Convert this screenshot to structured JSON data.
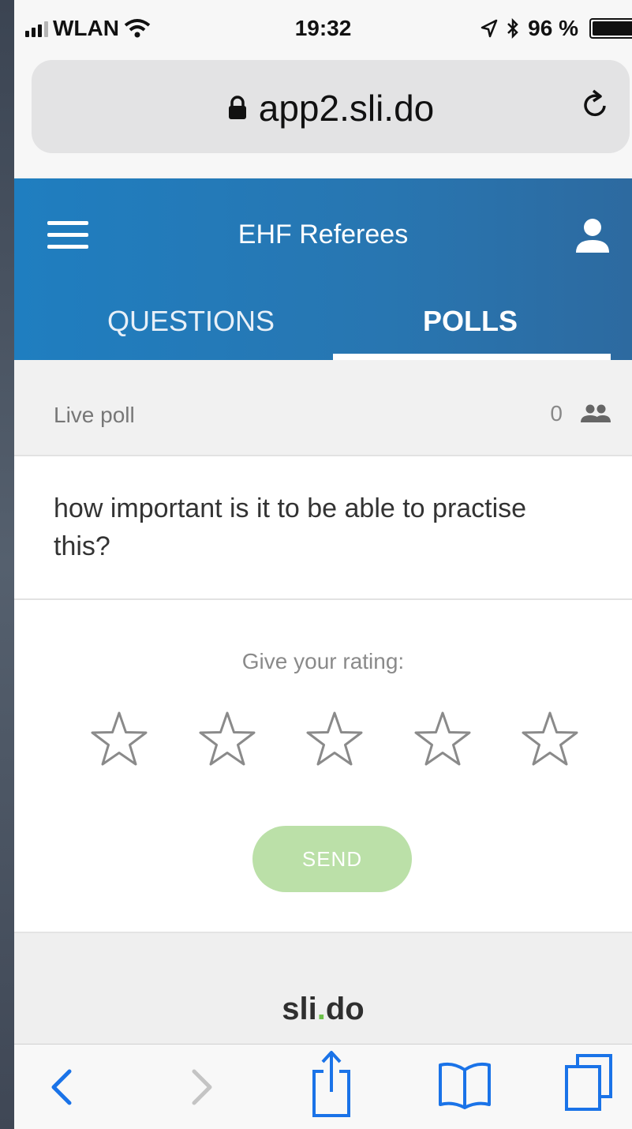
{
  "status_bar": {
    "carrier": "WLAN",
    "time": "19:32",
    "battery": "96 %"
  },
  "browser": {
    "url": "app2.sli.do",
    "icons": [
      "lock-icon",
      "reload-icon"
    ]
  },
  "app_header": {
    "title": "EHF Referees",
    "tabs": [
      {
        "label": "QUESTIONS",
        "active": false
      },
      {
        "label": "POLLS",
        "active": true
      }
    ],
    "accent_color": "#1f7ec0"
  },
  "poll": {
    "status_label": "Live poll",
    "participants_count": "0",
    "question": "how important is it to be able to practise this?",
    "rating_prompt": "Give your rating:",
    "rating_value": 0,
    "rating_max": 5,
    "send_label": "SEND",
    "send_color": "#bbe0a8"
  },
  "footer": {
    "brand_main": "sli",
    "brand_dot": ".",
    "brand_end": "do"
  },
  "toolbar": {
    "icons": [
      "back-icon",
      "forward-icon",
      "share-icon",
      "bookmarks-icon",
      "tabs-icon"
    ]
  }
}
